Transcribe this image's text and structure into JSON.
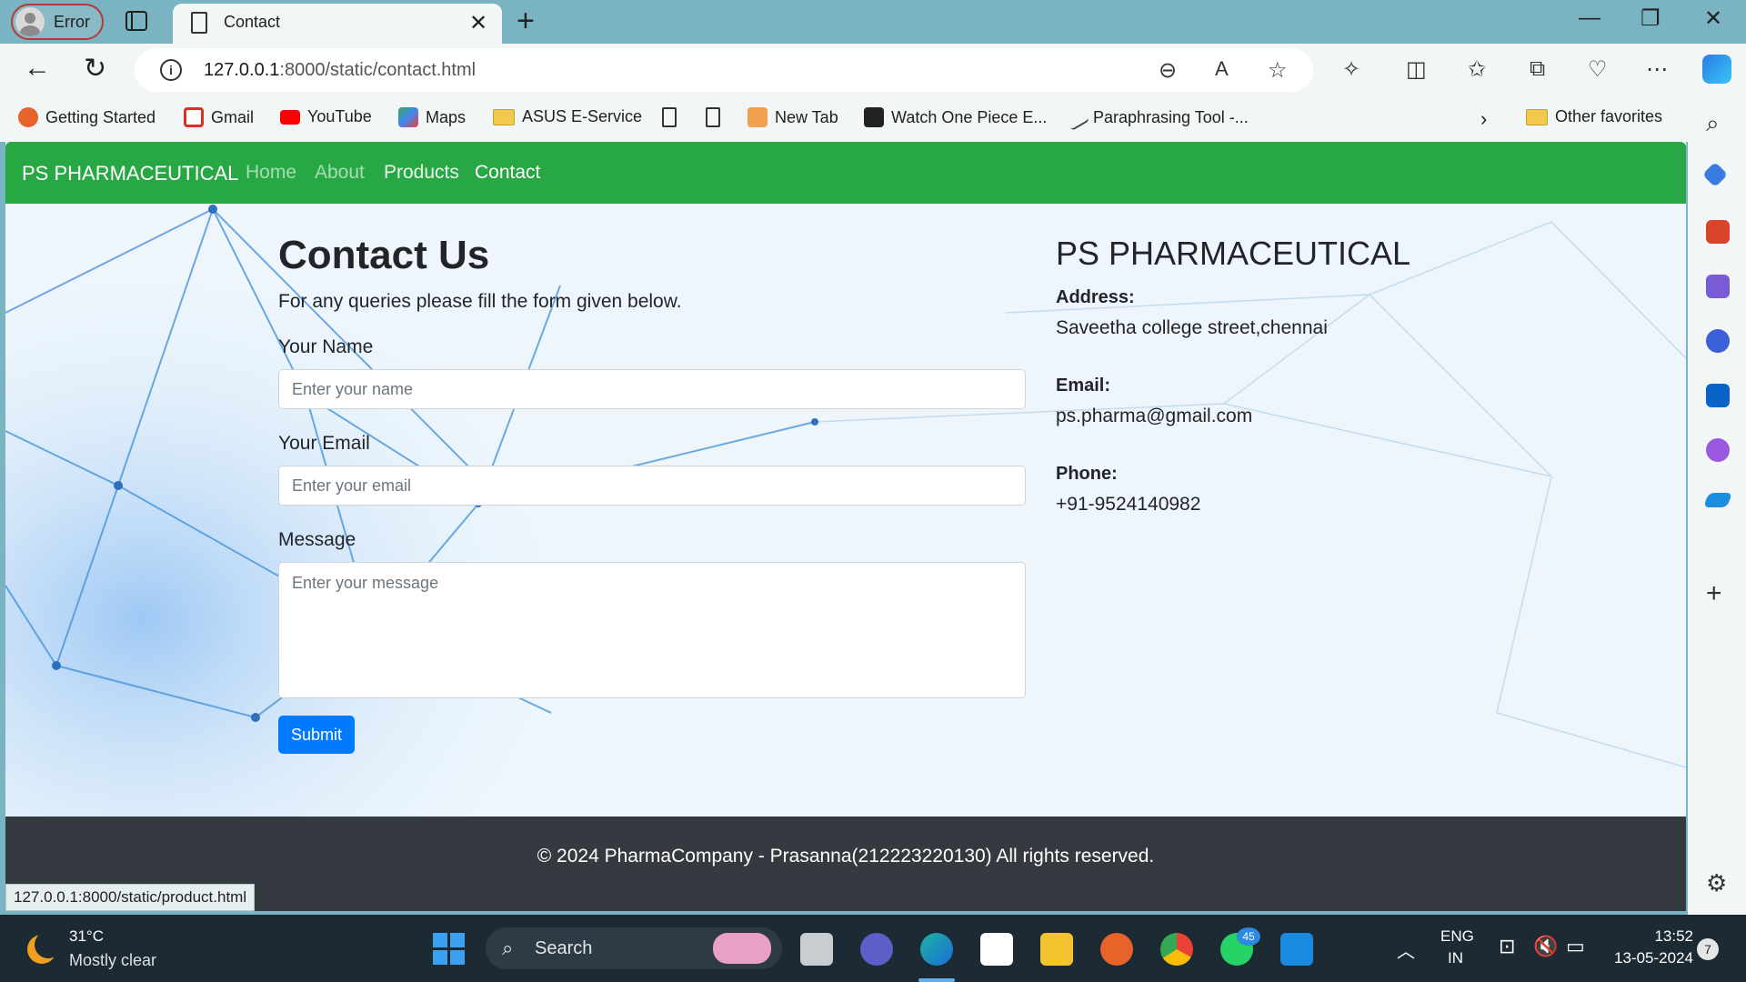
{
  "browser": {
    "profile_label": "Error",
    "tab_title": "Contact",
    "url_host": "127.0.0.1",
    "url_path": ":8000/static/contact.html",
    "favorites": [
      "Getting Started",
      "Gmail",
      "YouTube",
      "Maps",
      "ASUS E-Service",
      "New Tab",
      "Watch One Piece E...",
      "Paraphrasing Tool -...",
      "Other favorites"
    ],
    "status_url": "127.0.0.1:8000/static/product.html"
  },
  "site": {
    "brand": "PS PHARMACEUTICAL",
    "nav": [
      "Home",
      "About",
      "Products",
      "Contact"
    ],
    "contact": {
      "heading": "Contact Us",
      "intro": "For any queries please fill the form given below.",
      "name_label": "Your Name",
      "name_placeholder": "Enter your name",
      "email_label": "Your Email",
      "email_placeholder": "Enter your email",
      "message_label": "Message",
      "message_placeholder": "Enter your message",
      "submit_label": "Submit"
    },
    "info": {
      "title": "PS PHARMACEUTICAL",
      "address_label": "Address:",
      "address": "Saveetha college street,chennai",
      "email_label": "Email:",
      "email": "ps.pharma@gmail.com",
      "phone_label": "Phone:",
      "phone": "+91-9524140982"
    },
    "footer": "© 2024 PharmaCompany - Prasanna(212223220130) All rights reserved."
  },
  "taskbar": {
    "temperature": "31°C",
    "weather": "Mostly clear",
    "search_label": "Search",
    "whatsapp_badge": "45",
    "lang_top": "ENG",
    "lang_bottom": "IN",
    "time": "13:52",
    "date": "13-05-2024",
    "notification_count": "7"
  },
  "colors": {
    "navbar": "#28a745",
    "submit": "#007bff",
    "footer": "#343a40"
  }
}
